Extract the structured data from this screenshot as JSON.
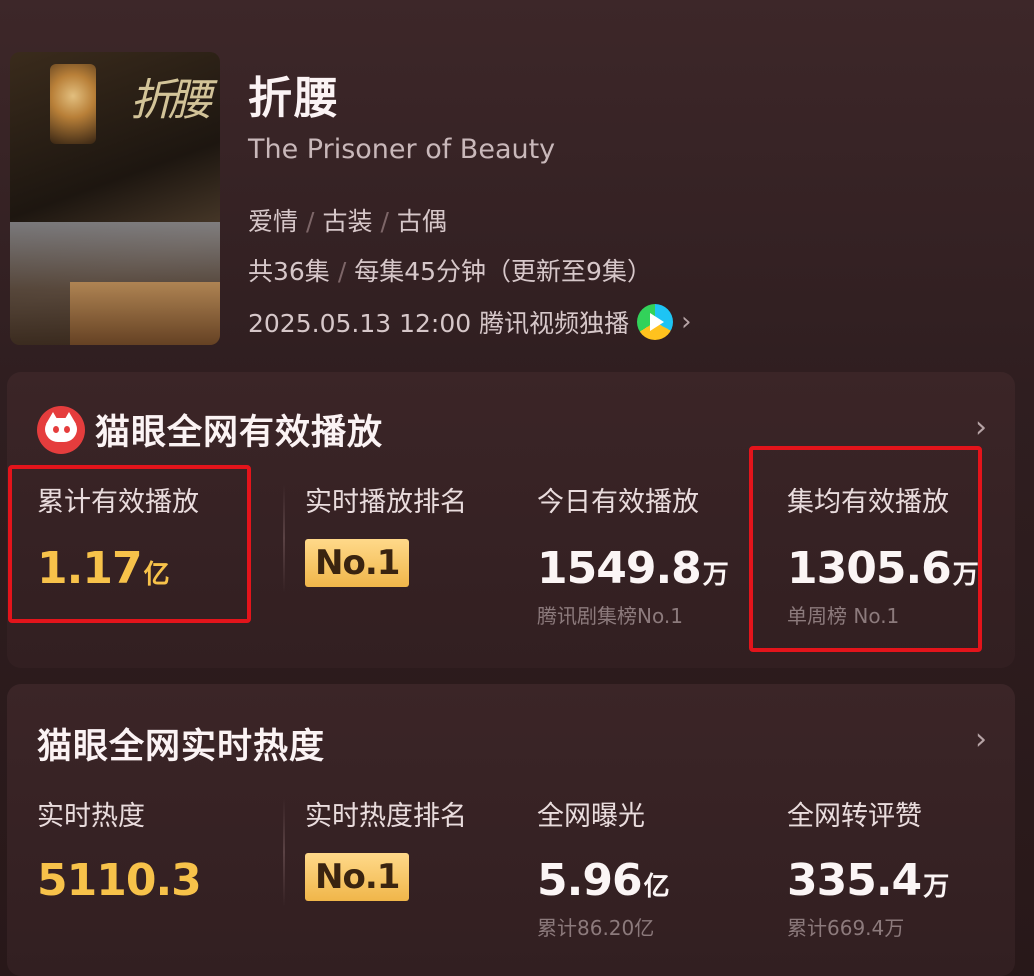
{
  "show": {
    "poster_title": "折腰",
    "title": "折腰",
    "english_title": "The Prisoner of Beauty",
    "genres": [
      "爱情",
      "古装",
      "古偶"
    ],
    "episodes": "共36集",
    "duration": "每集45分钟（更新至9集）",
    "release": "2025.05.13 12:00 腾讯视频独播"
  },
  "playback_card": {
    "title": "猫眼全网有效播放",
    "stats": {
      "total": {
        "label": "累计有效播放",
        "value": "1.17",
        "unit": "亿"
      },
      "rank": {
        "label": "实时播放排名",
        "badge": "No.1"
      },
      "today": {
        "label": "今日有效播放",
        "value": "1549.8",
        "unit": "万",
        "sub": "腾讯剧集榜No.1"
      },
      "per_episode": {
        "label": "集均有效播放",
        "value": "1305.6",
        "unit": "万",
        "sub": "单周榜 No.1"
      }
    }
  },
  "heat_card": {
    "title": "猫眼全网实时热度",
    "stats": {
      "heat": {
        "label": "实时热度",
        "value": "5110.3"
      },
      "rank": {
        "label": "实时热度排名",
        "badge": "No.1"
      },
      "exposure": {
        "label": "全网曝光",
        "value": "5.96",
        "unit": "亿",
        "sub": "累计86.20亿"
      },
      "engagement": {
        "label": "全网转评赞",
        "value": "335.4",
        "unit": "万",
        "sub": "累计669.4万"
      }
    }
  },
  "colors": {
    "accent_gold": "#f7c24a",
    "highlight_red": "#e3141b",
    "background": "#2f1e20"
  }
}
